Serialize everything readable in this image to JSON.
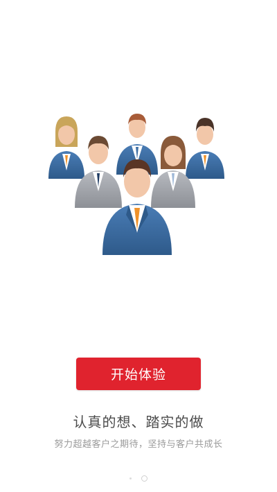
{
  "onboarding": {
    "start_button_label": "开始体验",
    "slogan": "认真的想、踏实的做",
    "subtitle": "努力超越客户之期待，坚持与客户共成长",
    "page_count": 2,
    "current_page": 1
  },
  "colors": {
    "accent": "#e0232e",
    "suit_blue": "#3f6fa4",
    "suit_gray": "#a8abb0",
    "tie_orange": "#f0922a",
    "skin": "#f2c7a9"
  },
  "illustration": {
    "icon": "business-team-icon"
  }
}
